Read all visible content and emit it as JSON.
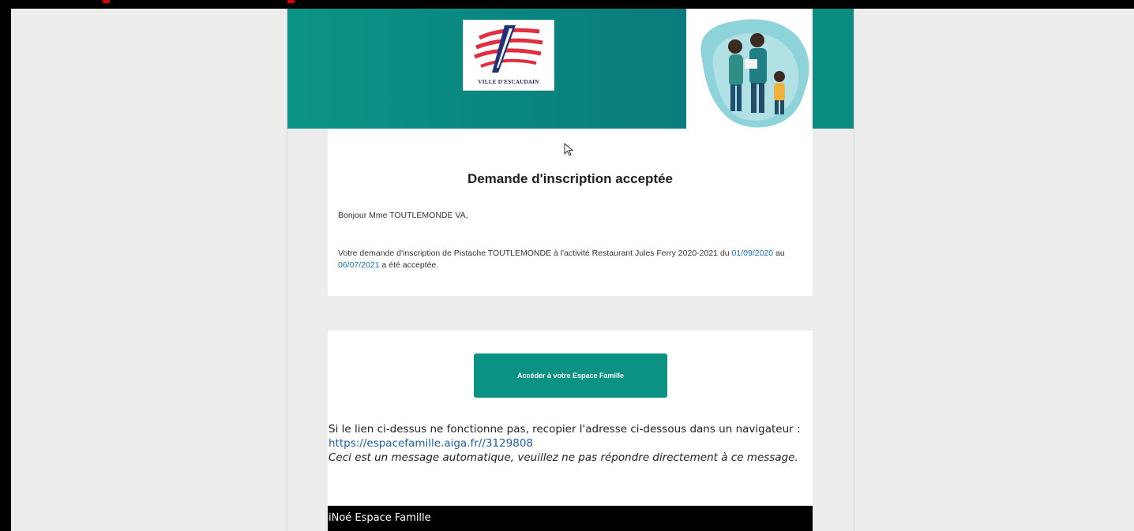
{
  "email": {
    "logo_text": "VILLE D'ESCAUDAIN",
    "title": "Demande d'inscription acceptée",
    "greeting": "Bonjour Mme TOUTLEMONDE VA,",
    "body_part1": "Votre demande d'inscription de Pistache TOUTLEMONDE à l'activité Restaurant Jules Ferry 2020-2021 du ",
    "date_start": "01/09/2020",
    "body_part2": " au ",
    "date_end": "06/07/2021",
    "body_part3": " a été acceptée.",
    "cta_label": "Accéder à votre Espace Famille",
    "fallback_text": "Si le lien ci-dessus ne fonctionne pas, recopier l'adresse ci-dessous dans un navigateur :",
    "fallback_url": "https://espacefamille.aiga.fr//3129808",
    "auto_notice": "Ceci est un message automatique, veuillez ne pas répondre directement à ce message.",
    "footer_text": "iNoé Espace Famille"
  },
  "colors": {
    "banner": "#0a8d80",
    "button": "#0a9382",
    "link": "#1a73c8",
    "footer": "#000000"
  },
  "icons": [
    "mouse-cursor-icon",
    "family-illustration",
    "city-logo"
  ]
}
